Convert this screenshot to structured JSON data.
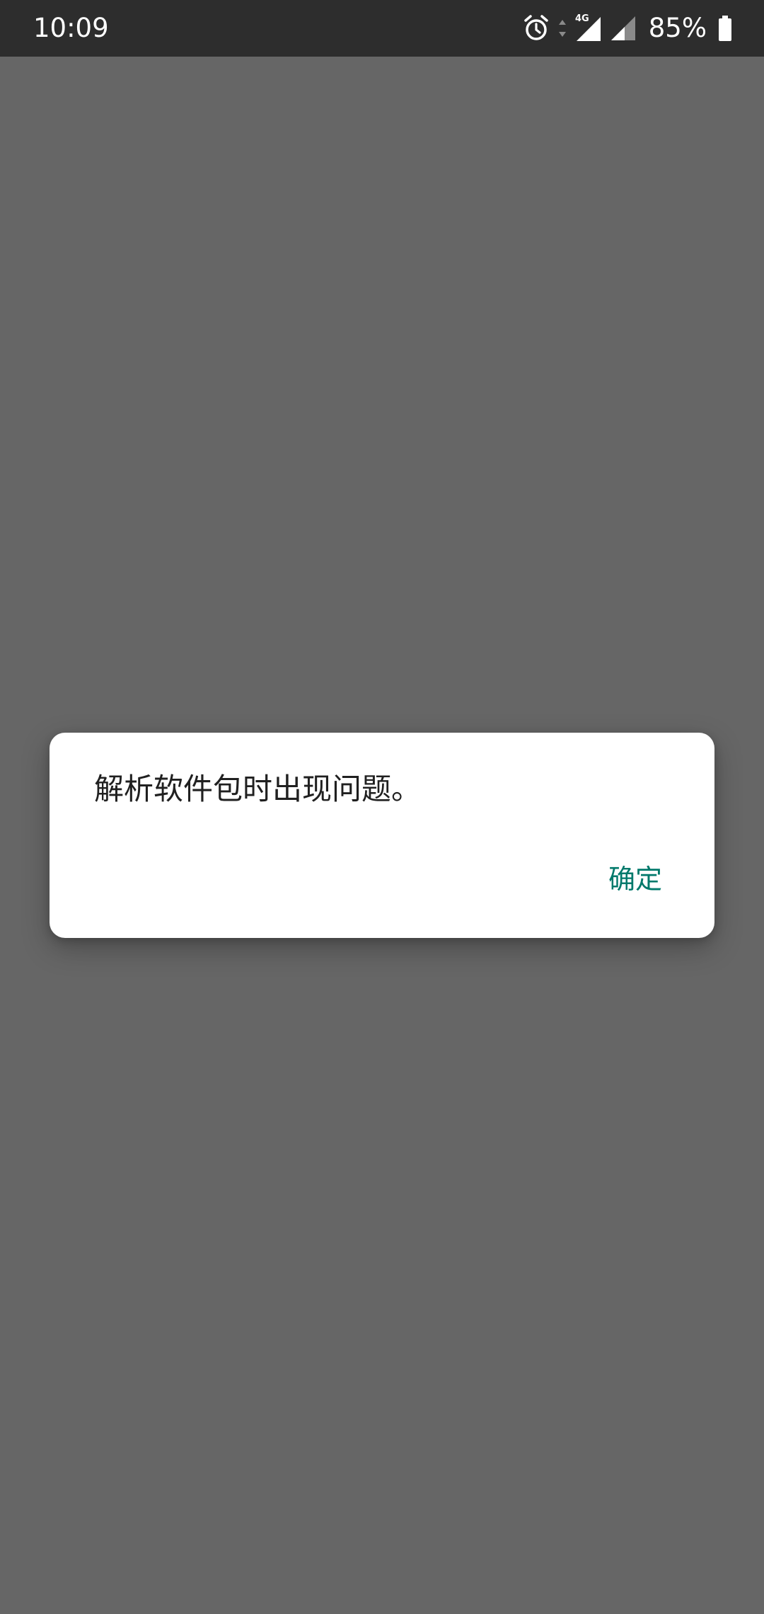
{
  "status_bar": {
    "time": "10:09",
    "network_label": "4G",
    "battery_percent": "85%",
    "icons": [
      "alarm-icon",
      "data-arrows-icon",
      "signal-4g-icon",
      "signal-icon",
      "battery-icon"
    ]
  },
  "dialog": {
    "message": "解析软件包时出现问题。",
    "ok_label": "确定",
    "accent_color": "#00796b"
  },
  "colors": {
    "status_bar_bg": "#2d2d2d",
    "scrim_bg": "#666666",
    "dialog_bg": "#ffffff"
  }
}
